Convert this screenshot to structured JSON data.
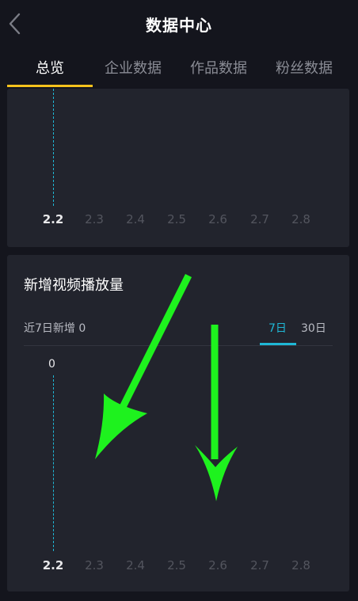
{
  "header": {
    "title": "数据中心",
    "back_icon": "chevron-left-icon"
  },
  "tabs": [
    {
      "label": "总览",
      "active": true
    },
    {
      "label": "企业数据",
      "active": false
    },
    {
      "label": "作品数据",
      "active": false
    },
    {
      "label": "粉丝数据",
      "active": false
    }
  ],
  "top_chart": {
    "x_ticks": [
      "2.2",
      "2.3",
      "2.4",
      "2.5",
      "2.6",
      "2.7",
      "2.8"
    ],
    "active_tick": "2.2"
  },
  "video_views": {
    "title": "新增视频播放量",
    "summary_label": "近7日新增",
    "summary_value": "0",
    "periods": [
      {
        "label": "7日",
        "active": true
      },
      {
        "label": "30日",
        "active": false
      }
    ],
    "chart_data": {
      "type": "line",
      "x": [
        "2.2",
        "2.3",
        "2.4",
        "2.5",
        "2.6",
        "2.7",
        "2.8"
      ],
      "highlighted_x": "2.2",
      "highlighted_value": 0
    },
    "y_value_label": "0"
  },
  "annotations": {
    "arrow_color": "#1ef21e",
    "arrow_count": 2
  }
}
